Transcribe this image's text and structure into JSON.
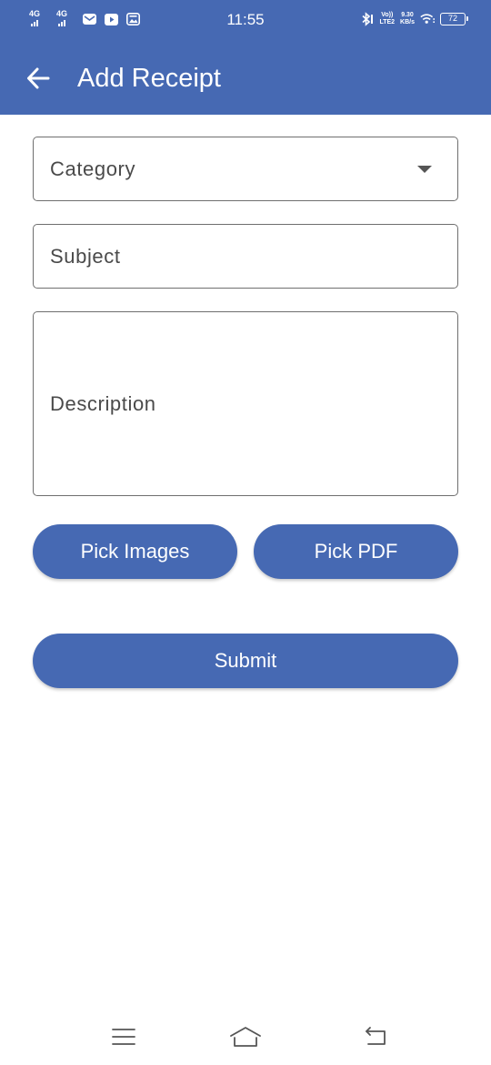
{
  "status_bar": {
    "sim1_label": "4G",
    "sim2_label": "4G",
    "time": "11:55",
    "volte_top": "Vo))",
    "volte_bottom": "LTE2",
    "speed_value": "9.30",
    "speed_unit": "KB/s",
    "battery": "72",
    "icons": [
      "signal-icon",
      "signal-icon",
      "mail-icon",
      "youtube-icon",
      "gallery-icon",
      "bluetooth-icon",
      "wifi-icon",
      "battery-icon"
    ]
  },
  "app_bar": {
    "title": "Add Receipt",
    "back_icon": "arrow-left-icon",
    "color": "#4669b3"
  },
  "form": {
    "category": {
      "placeholder": "Category",
      "icon": "dropdown-arrow-icon"
    },
    "subject": {
      "placeholder": "Subject"
    },
    "description": {
      "placeholder": "Description"
    }
  },
  "buttons": {
    "pick_images": "Pick Images",
    "pick_pdf": "Pick PDF",
    "submit": "Submit"
  },
  "nav_bar": {
    "icons": [
      "menu-icon",
      "home-icon",
      "back-icon"
    ]
  }
}
